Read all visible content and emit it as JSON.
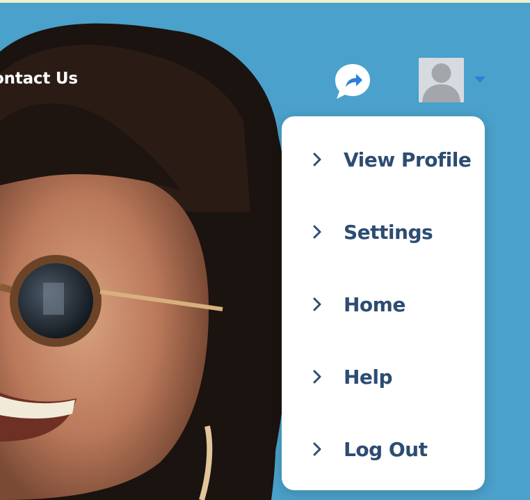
{
  "nav": {
    "contact_label": "ontact Us"
  },
  "header": {
    "share_icon": "share-arrow-icon",
    "avatar_icon": "user-avatar-icon",
    "dropdown_icon": "caret-down-icon",
    "accent_color": "#2e7fd9"
  },
  "menu": {
    "items": [
      {
        "label": "View Profile",
        "icon": "chevron-right-icon"
      },
      {
        "label": "Settings",
        "icon": "chevron-right-icon"
      },
      {
        "label": "Home",
        "icon": "chevron-right-icon"
      },
      {
        "label": "Help",
        "icon": "chevron-right-icon"
      },
      {
        "label": "Log Out",
        "icon": "chevron-right-icon"
      }
    ],
    "text_color": "#2d4c72"
  }
}
